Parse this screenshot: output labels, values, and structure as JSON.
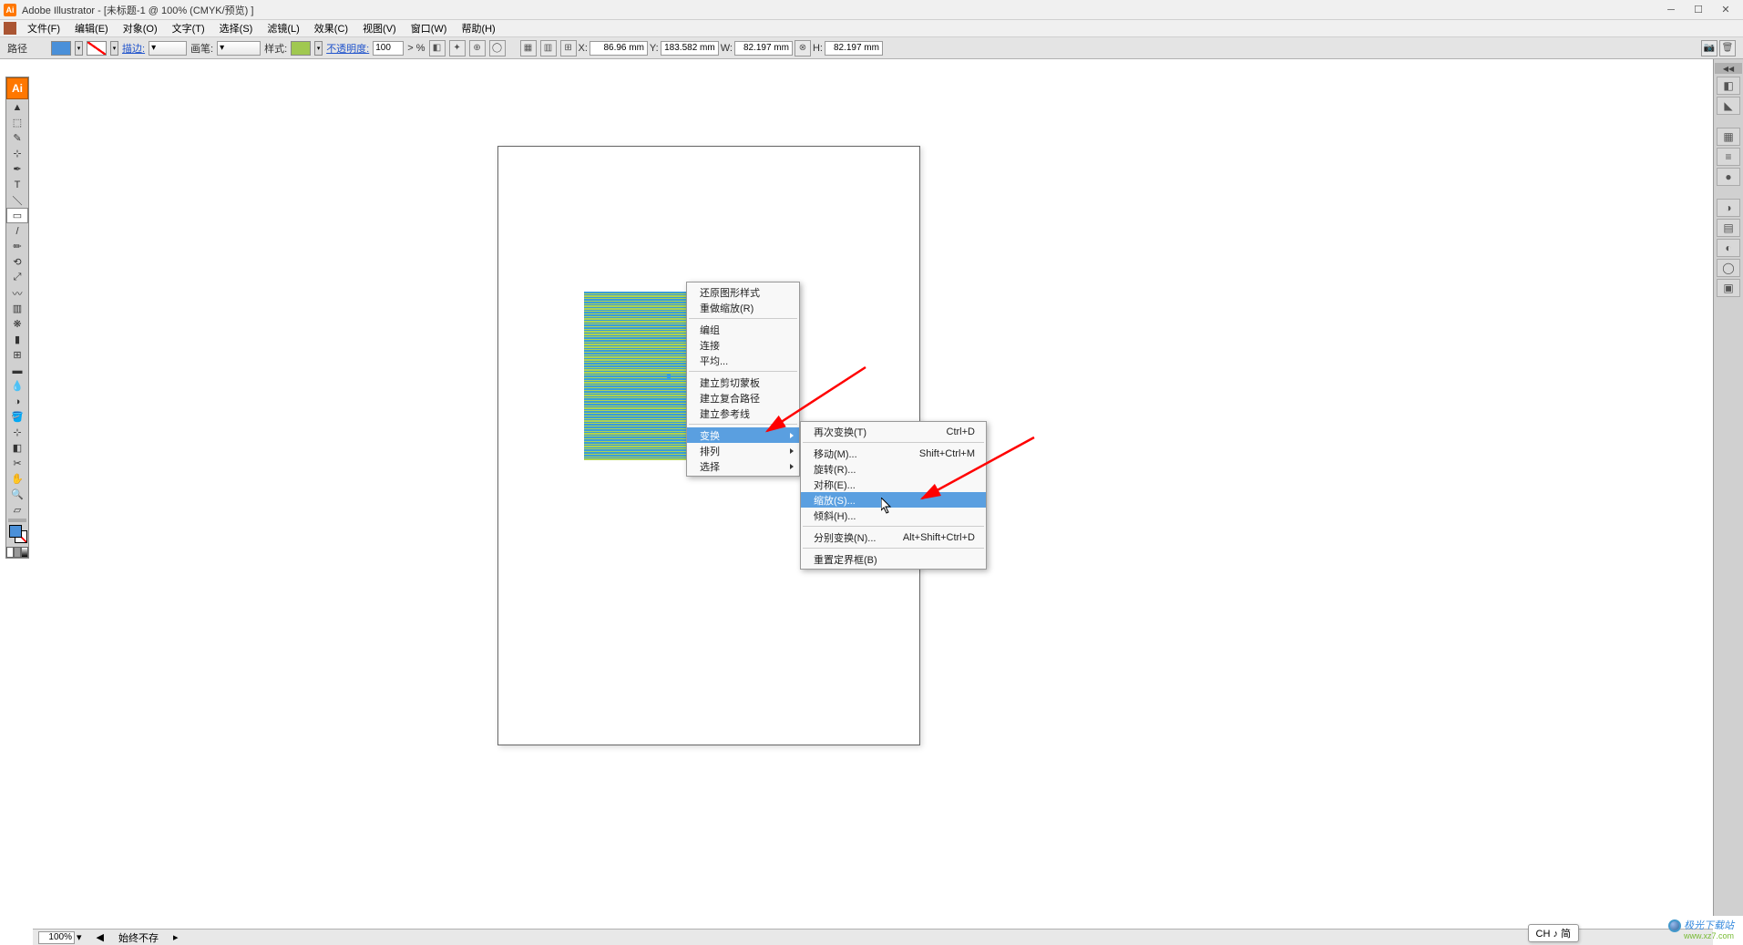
{
  "app": {
    "title": "Adobe Illustrator - [未标题-1 @ 100% (CMYK/预览) ]",
    "logo_letter": "Ai"
  },
  "menubar": {
    "items": [
      "文件(F)",
      "编辑(E)",
      "对象(O)",
      "文字(T)",
      "选择(S)",
      "滤镜(L)",
      "效果(C)",
      "视图(V)",
      "窗口(W)",
      "帮助(H)"
    ]
  },
  "controlbar": {
    "mode": "路径",
    "stroke_label": "描边:",
    "stroke_weight": "",
    "brush_label": "画笔:",
    "style_label": "样式:",
    "opacity_label": "不透明度:",
    "opacity_value": "100",
    "opacity_suffix": "> %",
    "x_label": "X:",
    "x_value": "86.96 mm",
    "y_label": "Y:",
    "y_value": "183.582 mm",
    "w_label": "W:",
    "w_value": "82.197 mm",
    "h_label": "H:",
    "h_value": "82.197 mm"
  },
  "context_menu_1": {
    "items": [
      {
        "label": "还原图形样式",
        "sep_before": false
      },
      {
        "label": "重做缩放(R)",
        "sep_after": true
      },
      {
        "label": "编组"
      },
      {
        "label": "连接"
      },
      {
        "label": "平均...",
        "sep_after": true
      },
      {
        "label": "建立剪切蒙板"
      },
      {
        "label": "建立复合路径"
      },
      {
        "label": "建立参考线",
        "sep_after": true
      },
      {
        "label": "变换",
        "submenu": true,
        "highlighted": true
      },
      {
        "label": "排列",
        "submenu": true
      },
      {
        "label": "选择",
        "submenu": true
      }
    ]
  },
  "context_menu_2": {
    "items": [
      {
        "label": "再次变换(T)",
        "shortcut": "Ctrl+D",
        "sep_after": true
      },
      {
        "label": "移动(M)...",
        "shortcut": "Shift+Ctrl+M"
      },
      {
        "label": "旋转(R)..."
      },
      {
        "label": "对称(E)..."
      },
      {
        "label": "缩放(S)...",
        "highlighted": true
      },
      {
        "label": "倾斜(H)...",
        "sep_after": true
      },
      {
        "label": "分别变换(N)...",
        "shortcut": "Alt+Shift+Ctrl+D",
        "sep_after": true
      },
      {
        "label": "重置定界框(B)"
      }
    ]
  },
  "statusbar": {
    "zoom": "100%",
    "status": "始终不存"
  },
  "imebar": {
    "text": "CH ♪ 简"
  },
  "watermark": {
    "brand": "极光下载站",
    "url": "www.xz7.com"
  },
  "right_panel_icons": [
    "◧",
    "◣",
    "▦",
    "≡",
    "●",
    "◑",
    "▤",
    "◐",
    "◯",
    "▣"
  ],
  "tool_icons": [
    "▲",
    "⬚",
    "✎",
    "⊹",
    "T",
    "＼",
    "▭",
    "/",
    "⟲",
    "✎",
    "⊞",
    "◇",
    "▥",
    "✂",
    "✦",
    "✢",
    "⊕",
    "⊞",
    "↔",
    "⬚",
    "✋",
    "🔍",
    "⬚"
  ]
}
